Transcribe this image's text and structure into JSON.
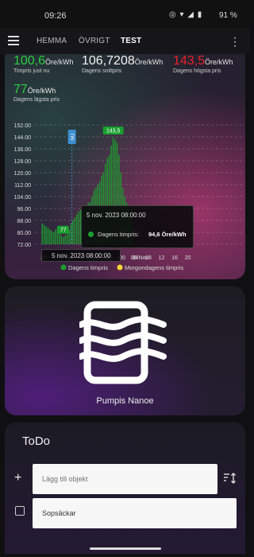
{
  "status_bar": {
    "time": "09:26",
    "battery": "91 %",
    "icons": "◎ ▾ ◢ ▮"
  },
  "app_bar": {
    "tabs": [
      "HEMMA",
      "ÖVRIGT",
      "TEST"
    ],
    "active_tab": "TEST"
  },
  "prices": {
    "current": {
      "value": "100,6",
      "unit": "Öre/kWh",
      "label": "Timpris just nu",
      "color": "#2ecc40"
    },
    "average": {
      "value": "106,7208",
      "unit": "Öre/kWh",
      "label": "Dagens snittpris",
      "color": "#f2f2f2"
    },
    "highest": {
      "value": "143,5",
      "unit": "Öre/kWh",
      "label": "Dagens högsta pris",
      "color": "#e8222a"
    },
    "lowest": {
      "value": "77",
      "unit": "Öre/kWh",
      "label": "Dagens lägsta pris",
      "color": "#2ecc40"
    }
  },
  "chart_data": {
    "type": "bar",
    "ylim": [
      72,
      152
    ],
    "yticks": [
      "152.00",
      "144.00",
      "136.00",
      "128.00",
      "120.00",
      "112.00",
      "104.00",
      "96.00",
      "88.00",
      "80.00",
      "72.00"
    ],
    "xticks": [
      "20",
      "04",
      "08",
      "12",
      "16",
      "20",
      "00",
      "04",
      "08",
      "12",
      "16",
      "20"
    ],
    "x_date_label": "06 Nov",
    "values": [
      86,
      85,
      84,
      83,
      82,
      81,
      80,
      82,
      84,
      79,
      78,
      77,
      78,
      79,
      82,
      86,
      88,
      90,
      92,
      94,
      95,
      94,
      96,
      98,
      100,
      100,
      104,
      108,
      110,
      112,
      114,
      118,
      120,
      126,
      130,
      132,
      138,
      143.5,
      142,
      140,
      132,
      120,
      110,
      104,
      100,
      98,
      96,
      95
    ],
    "max_label": "143,5",
    "min_label": "77",
    "now_marker": "NU",
    "series": [
      {
        "name": "Dagens timpris",
        "color": "#1a9e2e"
      },
      {
        "name": "Morgondagens timpris",
        "color": "#f5d533"
      }
    ],
    "tooltip": {
      "title": "5 nov. 2023 08:00:00",
      "series": "Dagens timpris:",
      "value": "94,6 Öre/kWh"
    },
    "x_tooltip": "5 nov. 2023 08:00:00"
  },
  "device": {
    "name": "Pumpis Nanoe"
  },
  "todo": {
    "title": "ToDo",
    "add_placeholder": "Lägg till objekt",
    "items": [
      "Sopsäckar"
    ]
  },
  "colors": {
    "accent_green": "#1a9e2e",
    "accent_red": "#e8222a"
  }
}
